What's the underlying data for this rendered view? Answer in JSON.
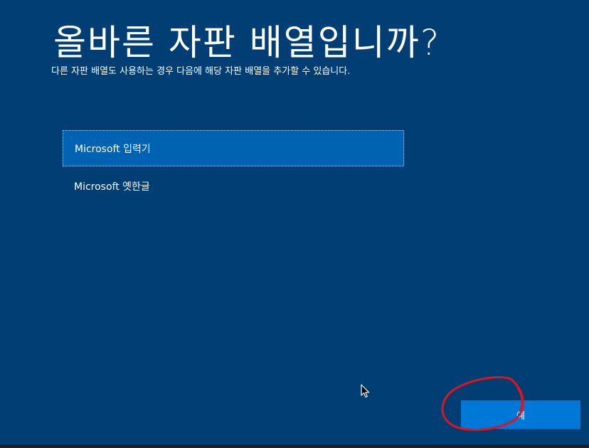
{
  "page": {
    "title": "올바른 자판 배열입니까?",
    "subtitle": "다른 자판 배열도 사용하는 경우 다음에 해당 자판 배열을 추가할 수 있습니다."
  },
  "options": [
    {
      "label": "Microsoft 입력기",
      "selected": true
    },
    {
      "label": "Microsoft 옛한글",
      "selected": false
    }
  ],
  "actions": {
    "yes_label": "예"
  },
  "colors": {
    "background": "#003e73",
    "selected_item": "#0063b1",
    "button": "#0078d7",
    "annotation": "#e0141e"
  },
  "icons": {
    "cursor": "mouse-pointer-icon",
    "annotation": "red-circle-annotation"
  }
}
